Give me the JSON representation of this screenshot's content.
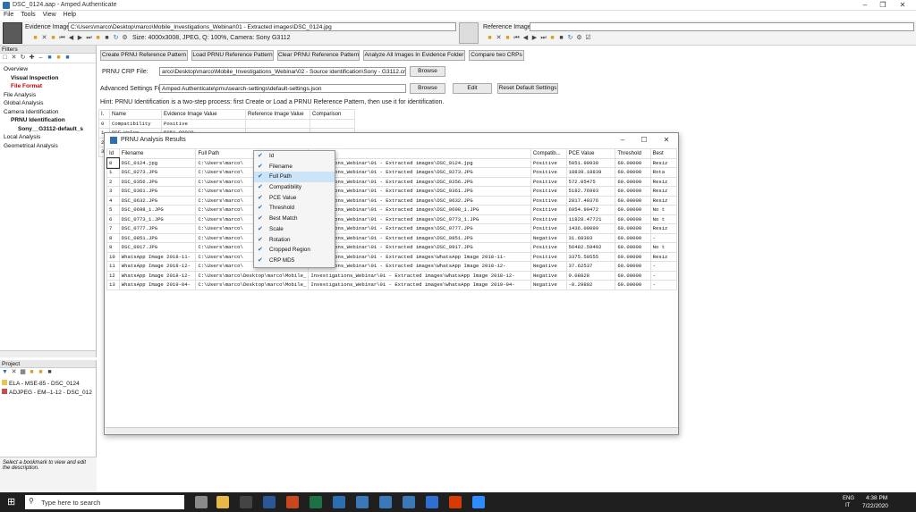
{
  "app": {
    "title": "DSC_0124.aap - Amped Authenticate"
  },
  "menu": [
    "File",
    "Tools",
    "View",
    "Help"
  ],
  "evidence": {
    "label": "Evidence Image:",
    "path": "C:\\Users\\marco\\Desktop\\marco\\Mobile_Investigations_Webinar\\01 - Extracted images\\DSC_0124.jpg",
    "info": "Size: 4000x3008, JPEG, Q: 100%, Camera: Sony G3112"
  },
  "reference": {
    "label": "Reference Image:",
    "path": ""
  },
  "filters": {
    "header": "Filters",
    "items": [
      {
        "label": "Overview",
        "indent": 0,
        "style": "normal"
      },
      {
        "label": "Visual Inspection",
        "indent": 1,
        "style": "bold"
      },
      {
        "label": "File Format",
        "indent": 1,
        "style": "red"
      },
      {
        "label": "File Analysis",
        "indent": 0,
        "style": "normal"
      },
      {
        "label": "Global Analysis",
        "indent": 0,
        "style": "normal"
      },
      {
        "label": "Camera Identification",
        "indent": 0,
        "style": "normal"
      },
      {
        "label": "PRNU Identification",
        "indent": 1,
        "style": "bold"
      },
      {
        "label": "Sony__G3112-default_s",
        "indent": 2,
        "style": "bold"
      },
      {
        "label": "Local Analysis",
        "indent": 0,
        "style": "normal"
      },
      {
        "label": "Geometrical Analysis",
        "indent": 0,
        "style": "normal"
      }
    ]
  },
  "project": {
    "header": "Project",
    "items": [
      "ELA - MSE-85 - DSC_0124",
      "ADJPEG - EM--1-12 - DSC_012"
    ]
  },
  "description": "Select a bookmark to view and edit the description.",
  "prnu": {
    "buttons": [
      "Create PRNU Reference Pattern",
      "Load PRNU Reference Pattern",
      "Clear PRNU Reference Pattern",
      "Analyze All Images In Evidence Folder",
      "Compare two CRPs"
    ],
    "crp_label": "PRNU CRP File:",
    "crp_value": "arco\\Desktop\\marco\\Mobile_Investigations_Webinar\\02 - Source identification\\Sony - G3112.crp",
    "browse": "Browse",
    "adv_label": "Advanced Settings File:",
    "adv_value": "Amped Authenticate\\prnu\\search-settings\\default-settings.json",
    "edit": "Edit",
    "reset": "Reset Default Settings",
    "hint": "Hint: PRNU Identification is a two-step process: first Create or Load a PRNU Reference Pattern, then use it for identification."
  },
  "bgtable": {
    "headers": [
      "I.",
      "Name",
      "Evidence Image Value",
      "Reference Image Value",
      "Comparison"
    ],
    "rows": [
      [
        "0",
        "Compatibility",
        "Positive"
      ],
      [
        "1",
        "PCE Value",
        "5051.90930"
      ],
      [
        "2",
        ""
      ],
      [
        "3",
        ""
      ]
    ]
  },
  "dialog": {
    "title": "PRNU Analysis Results",
    "headers": [
      "Id",
      "Filename",
      "Full Path",
      "",
      "Compatib...",
      "PCE Value",
      "Threshold",
      "Best"
    ],
    "rows": [
      [
        "0",
        "DSC_0124.jpg",
        "C:\\Users\\marco\\",
        "nstigations_Webinar\\01 - Extracted images\\DSC_0124.jpg",
        "Positive",
        "5051.90930",
        "60.00000",
        "Resiz"
      ],
      [
        "1",
        "DSC_0273.JPG",
        "C:\\Users\\marco\\",
        "nstigations_Webinar\\01 - Extracted images\\DSC_0273.JPG",
        "Positive",
        "18839.18839",
        "60.00000",
        "Rota"
      ],
      [
        "2",
        "DSC_0356.JPG",
        "C:\\Users\\marco\\",
        "nstigations_Webinar\\01 - Extracted images\\DSC_0356.JPG",
        "Positive",
        "572.05475",
        "60.00000",
        "Resiz"
      ],
      [
        "3",
        "DSC_0361.JPG",
        "C:\\Users\\marco\\",
        "nstigations_Webinar\\01 - Extracted images\\DSC_0361.JPG",
        "Positive",
        "5182.76993",
        "60.00000",
        "Resiz"
      ],
      [
        "4",
        "DSC_0632.JPG",
        "C:\\Users\\marco\\",
        "nstigations_Webinar\\01 - Extracted images\\DSC_0632.JPG",
        "Positive",
        "2817.49376",
        "60.00000",
        "Resiz"
      ],
      [
        "5",
        "DSC_0698_1.JPG",
        "C:\\Users\\marco\\",
        "nstigations_Webinar\\01 - Extracted images\\DSC_0698_1.JPG",
        "Positive",
        "6954.90472",
        "60.00000",
        "No t"
      ],
      [
        "6",
        "DSC_0773_1.JPG",
        "C:\\Users\\marco\\",
        "nstigations_Webinar\\01 - Extracted images\\DSC_0773_1.JPG",
        "Positive",
        "11828.47721",
        "60.00000",
        "No t"
      ],
      [
        "7",
        "DSC_0777.JPG",
        "C:\\Users\\marco\\",
        "nstigations_Webinar\\01 - Extracted images\\DSC_0777.JPG",
        "Positive",
        "1436.09099",
        "60.00000",
        "Resiz"
      ],
      [
        "8",
        "DSC_0851.JPG",
        "C:\\Users\\marco\\",
        "nstigations_Webinar\\01 - Extracted images\\DSC_0851.JPG",
        "Negative",
        "31.68303",
        "60.00000",
        "-"
      ],
      [
        "9",
        "DSC_0917.JPG",
        "C:\\Users\\marco\\",
        "nstigations_Webinar\\01 - Extracted images\\DSC_0917.JPG",
        "Positive",
        "56482.59492",
        "60.00000",
        "No t"
      ],
      [
        "10",
        "WhatsApp Image 2018-11-",
        "C:\\Users\\marco\\",
        "nstigations_Webinar\\01 - Extracted images\\WhatsApp Image 2018-11-",
        "Positive",
        "3375.50555",
        "60.00000",
        "Resiz"
      ],
      [
        "11",
        "WhatsApp Image 2018-12-",
        "C:\\Users\\marco\\",
        "nstigations_Webinar\\01 - Extracted images\\WhatsApp Image 2018-12-",
        "Negative",
        "37.62537",
        "60.00000",
        "-"
      ],
      [
        "12",
        "WhatsApp Image 2018-12-",
        "C:\\Users\\marco\\Desktop\\marco\\Mobile_",
        "Investigations_Webinar\\01 - Extracted images\\WhatsApp Image 2018-12-",
        "Negative",
        "0.08828",
        "60.00000",
        "-"
      ],
      [
        "13",
        "WhatsApp Image 2019-04-",
        "C:\\Users\\marco\\Desktop\\marco\\Mobile_",
        "Investigations_Webinar\\01 - Extracted images\\WhatsApp Image 2019-04-",
        "Negative",
        "-0.29802",
        "60.00000",
        "-"
      ]
    ]
  },
  "context_menu": [
    {
      "label": "Id",
      "checked": true
    },
    {
      "label": "Filename",
      "checked": true
    },
    {
      "label": "Full Path",
      "checked": true,
      "highlight": true
    },
    {
      "label": "Compatibility",
      "checked": true
    },
    {
      "label": "PCE Value",
      "checked": true
    },
    {
      "label": "Threshold",
      "checked": true
    },
    {
      "label": "Best Match",
      "checked": true
    },
    {
      "label": "Scale",
      "checked": true
    },
    {
      "label": "Rotation",
      "checked": true
    },
    {
      "label": "Cropped Region",
      "checked": true
    },
    {
      "label": "CRP MD5",
      "checked": true
    }
  ],
  "taskbar": {
    "search": "Type here to search",
    "lang": "ENG",
    "lang2": "IT",
    "time": "4:38 PM",
    "date": "7/22/2020"
  }
}
